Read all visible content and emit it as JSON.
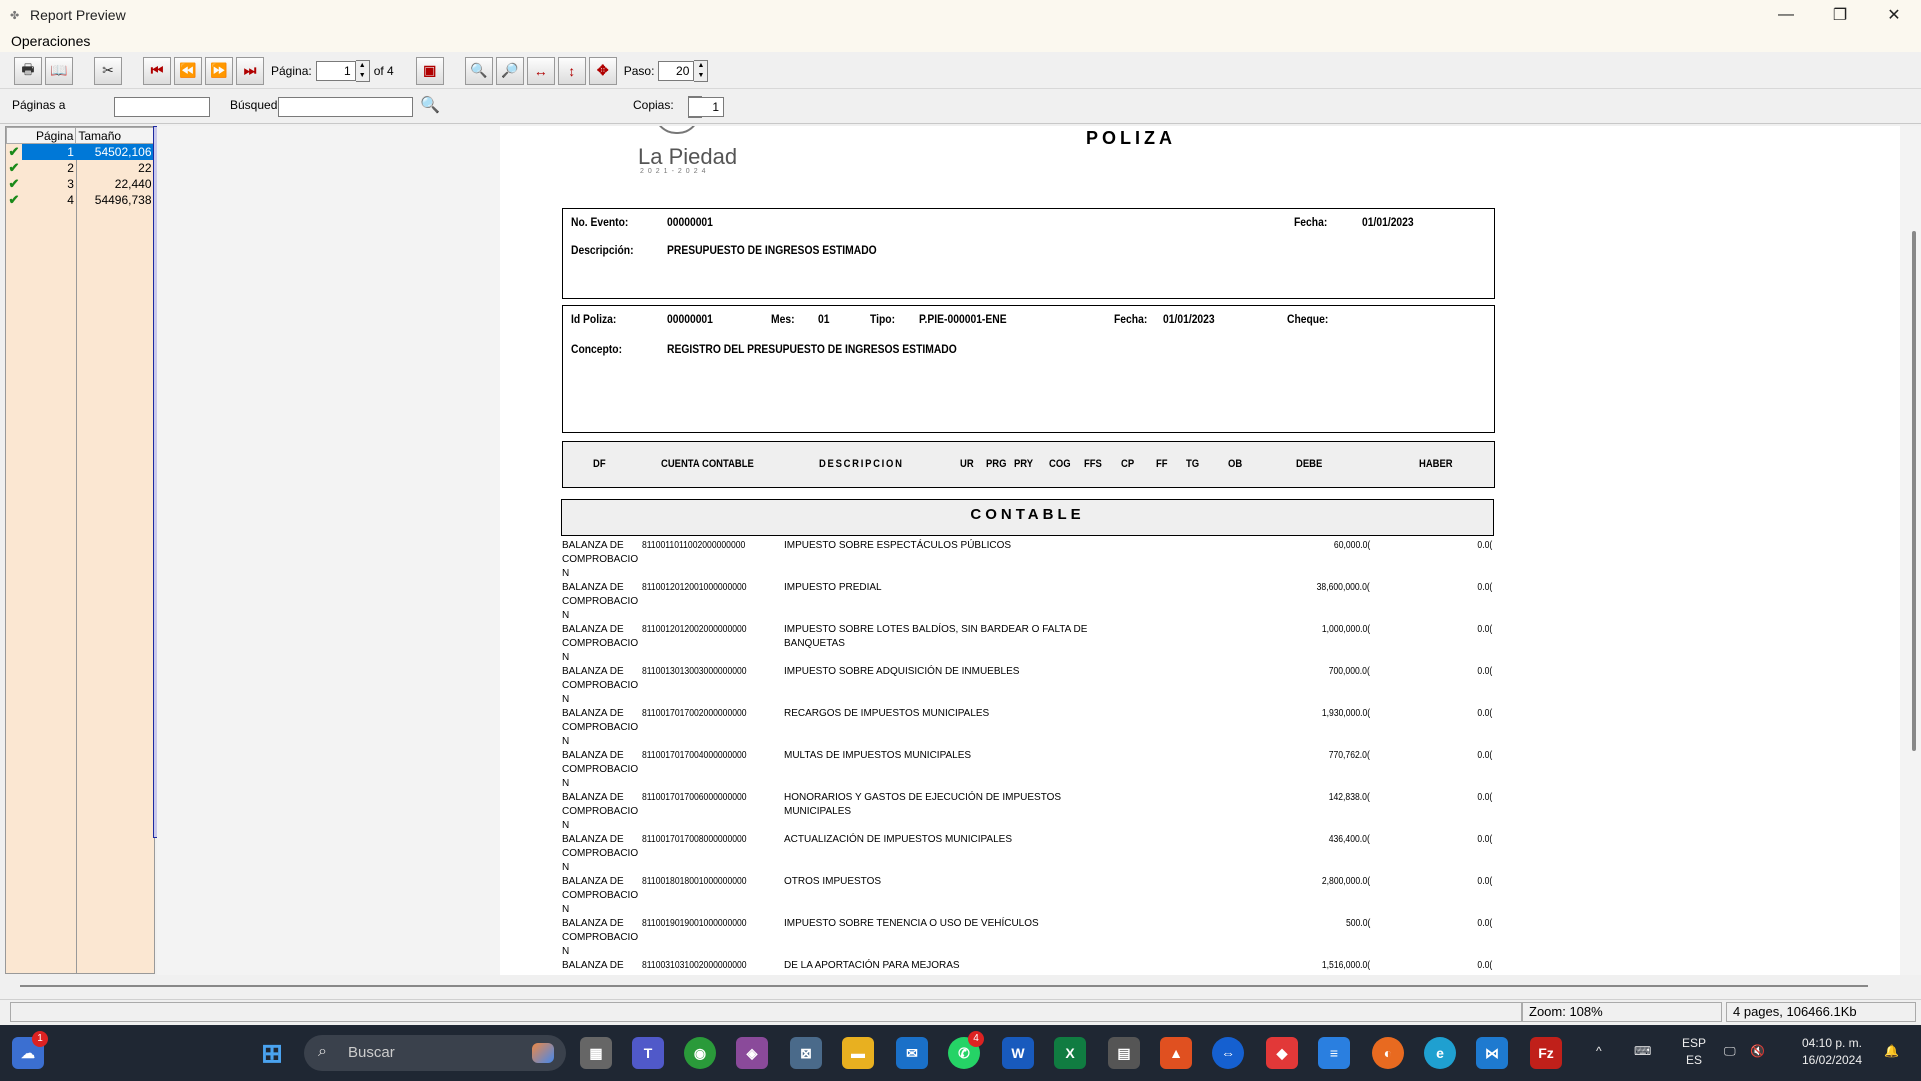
{
  "window": {
    "title": "Report Preview",
    "minimize": "—",
    "restore": "❐",
    "close": "✕"
  },
  "menu": {
    "operaciones": "Operaciones"
  },
  "toolbar": {
    "pagina_label": "Página:",
    "pagina_value": "1",
    "of_label": "of 4",
    "paso_label": "Paso:",
    "paso_value": "20"
  },
  "toolbar2": {
    "paginas_a_label": "Páginas a",
    "busqueda_label": "Búsqued",
    "copias_label": "Copias:",
    "copias_value": "1"
  },
  "thumbs": {
    "headers": {
      "pagina": "Página",
      "tamano": "Tamaño"
    },
    "rows": [
      {
        "num": "1",
        "size": "54502,106"
      },
      {
        "num": "2",
        "size": "22"
      },
      {
        "num": "3",
        "size": "22,440"
      },
      {
        "num": "4",
        "size": "54496,738"
      }
    ]
  },
  "report": {
    "logo_name": "La Piedad",
    "logo_years": "2021-2024",
    "title": "POLIZA",
    "no_evento_label": "No. Evento:",
    "no_evento": "00000001",
    "fecha_label": "Fecha:",
    "fecha": "01/01/2023",
    "descripcion_label": "Descripción:",
    "descripcion": "PRESUPUESTO DE INGRESOS ESTIMADO",
    "id_poliza_label": "Id Poliza:",
    "id_poliza": "00000001",
    "mes_label": "Mes:",
    "mes": "01",
    "tipo_label": "Tipo:",
    "tipo": "P.PIE-000001-ENE",
    "fecha2_label": "Fecha:",
    "fecha2": "01/01/2023",
    "cheque_label": "Cheque:",
    "concepto_label": "Concepto:",
    "concepto": "REGISTRO DEL PRESUPUESTO DE INGRESOS ESTIMADO",
    "columns": {
      "df": "DF",
      "cuenta": "CUENTA CONTABLE",
      "descripcion": "DESCRIPCION",
      "ur": "UR",
      "prg": "PRG",
      "pry": "PRY",
      "cog": "COG",
      "ffs": "FFS",
      "cp": "CP",
      "ff": "FF",
      "tg": "TG",
      "ob": "OB",
      "debe": "DEBE",
      "haber": "HABER"
    },
    "section": "CONTABLE",
    "rows": [
      {
        "bal": "BALANZA DE COMPROBACIO N",
        "cuenta": "8110011011002000000000",
        "desc": "IMPUESTO SOBRE ESPECTÁCULOS PÚBLICOS",
        "debe": "60,000.0(",
        "haber": "0.0("
      },
      {
        "bal": "BALANZA DE COMPROBACIO N",
        "cuenta": "8110012012001000000000",
        "desc": "IMPUESTO PREDIAL",
        "debe": "38,600,000.0(",
        "haber": "0.0("
      },
      {
        "bal": "BALANZA DE COMPROBACIO N",
        "cuenta": "8110012012002000000000",
        "desc": "IMPUESTO SOBRE LOTES BALDÍOS, SIN BARDEAR O FALTA DE BANQUETAS",
        "debe": "1,000,000.0(",
        "haber": "0.0("
      },
      {
        "bal": "BALANZA DE COMPROBACIO N",
        "cuenta": "8110013013003000000000",
        "desc": "IMPUESTO SOBRE ADQUISICIÓN DE INMUEBLES",
        "debe": "700,000.0(",
        "haber": "0.0("
      },
      {
        "bal": "BALANZA DE COMPROBACIO N",
        "cuenta": "8110017017002000000000",
        "desc": "RECARGOS DE IMPUESTOS MUNICIPALES",
        "debe": "1,930,000.0(",
        "haber": "0.0("
      },
      {
        "bal": "BALANZA DE COMPROBACIO N",
        "cuenta": "8110017017004000000000",
        "desc": "MULTAS DE IMPUESTOS MUNICIPALES",
        "debe": "770,762.0(",
        "haber": "0.0("
      },
      {
        "bal": "BALANZA DE COMPROBACIO N",
        "cuenta": "8110017017006000000000",
        "desc": "HONORARIOS Y GASTOS DE EJECUCIÓN DE IMPUESTOS MUNICIPALES",
        "debe": "142,838.0(",
        "haber": "0.0("
      },
      {
        "bal": "BALANZA DE COMPROBACIO N",
        "cuenta": "8110017017008000000000",
        "desc": "ACTUALIZACIÓN DE IMPUESTOS MUNICIPALES",
        "debe": "436,400.0(",
        "haber": "0.0("
      },
      {
        "bal": "BALANZA DE COMPROBACIO N",
        "cuenta": "8110018018001000000000",
        "desc": "OTROS IMPUESTOS",
        "debe": "2,800,000.0(",
        "haber": "0.0("
      },
      {
        "bal": "BALANZA DE COMPROBACIO N",
        "cuenta": "8110019019001000000000",
        "desc": "IMPUESTO SOBRE TENENCIA O USO DE VEHÍCULOS",
        "debe": "500.0(",
        "haber": "0.0("
      },
      {
        "bal": "BALANZA DE",
        "cuenta": "8110031031002000000000",
        "desc": "DE LA APORTACIÓN PARA MEJORAS",
        "debe": "1,516,000.0(",
        "haber": "0.0("
      }
    ]
  },
  "status": {
    "zoom": "Zoom: 108%",
    "pages": "4 pages, 106466.1Kb"
  },
  "taskbar": {
    "search_placeholder": "Buscar",
    "weather_badge": "1",
    "whatsapp_badge": "4",
    "lang_top": "ESP",
    "lang_bottom": "ES",
    "time": "04:10 p. m.",
    "date": "16/02/2024"
  }
}
